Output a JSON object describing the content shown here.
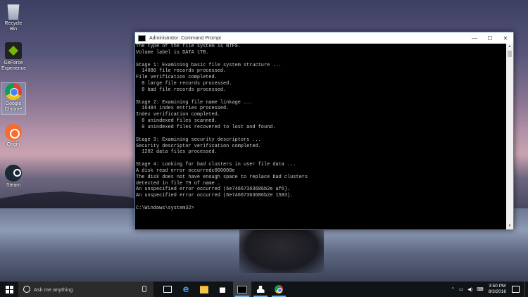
{
  "desktop": {
    "icons": [
      {
        "label": "Recycle Bin"
      },
      {
        "label": "GeForce Experience"
      },
      {
        "label": "Google Chrome"
      },
      {
        "label": "Origin"
      },
      {
        "label": "Steam"
      }
    ]
  },
  "window": {
    "title": "Administrator: Command Prompt",
    "controls": {
      "minimize": "—",
      "maximize": "☐",
      "close": "✕"
    },
    "console_lines": [
      "The type of the file system is NTFS.",
      "Volume label is DATA 1TB.",
      "",
      "Stage 1: Examining basic file system structure ...",
      "  14080 file records processed.",
      "File verification completed.",
      "  0 large file records processed.",
      "  0 bad file records processed.",
      "",
      "Stage 2: Examining file name linkage ...",
      "  16484 index entries processed.",
      "Index verification completed.",
      "  0 unindexed files scanned.",
      "  0 unindexed files recovered to lost and found.",
      "",
      "Stage 3: Examining security descriptors ...",
      "Security descriptor verification completed.",
      "  1202 data files processed.",
      "",
      "Stage 4: Looking for bad clusters in user file data ...",
      "A disk read error occurredc000000e",
      "The disk does not have enough space to replace bad clusters",
      "detected in file 79 of name .",
      "An unspecified error occurred (6e74667363686b2e af6).",
      "An unspecified error occurred (6e74667363686b2e 1583).",
      "",
      "C:\\Windows\\system32>"
    ]
  },
  "taskbar": {
    "search_placeholder": "Ask me anything",
    "time": "3:50 PM",
    "date": "8/3/2016",
    "tray_icons": [
      "chevron-up",
      "network",
      "volume",
      "keyboard"
    ]
  }
}
